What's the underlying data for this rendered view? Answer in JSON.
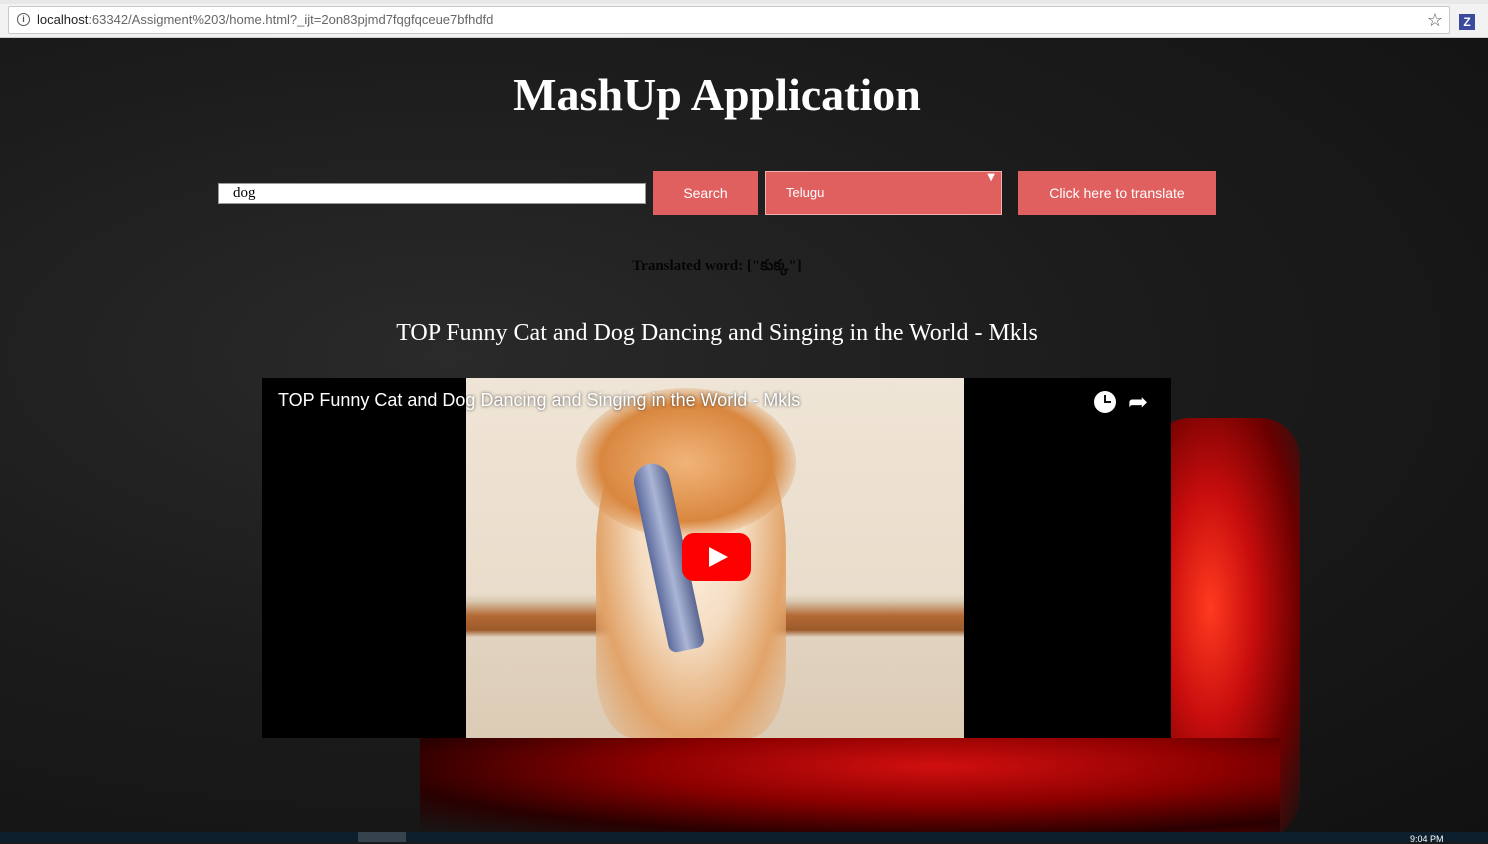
{
  "browser": {
    "url_host": "localhost",
    "url_rest": ":63342/Assigment%203/home.html?_ijt=2on83pjmd7fqgfqceue7bfhdfd",
    "extension_label": "Z"
  },
  "page": {
    "title": "MashUp Application",
    "search": {
      "value": "dog",
      "button_label": "Search"
    },
    "language_select": {
      "selected": "Telugu"
    },
    "translate_button_label": "Click here to translate",
    "translated_text": "Translated word:  [\"కుక్క\"]",
    "video_heading": "TOP Funny Cat and Dog Dancing and Singing in the World - Mkls"
  },
  "player": {
    "title": "TOP Funny Cat and Dog Dancing and Singing in the World - Mkls",
    "icons": [
      "clock-icon",
      "share-icon",
      "play-icon"
    ]
  },
  "taskbar": {
    "clock": "9:04 PM"
  },
  "colors": {
    "button_bg": "#e06060",
    "play_red": "#ff0000"
  }
}
